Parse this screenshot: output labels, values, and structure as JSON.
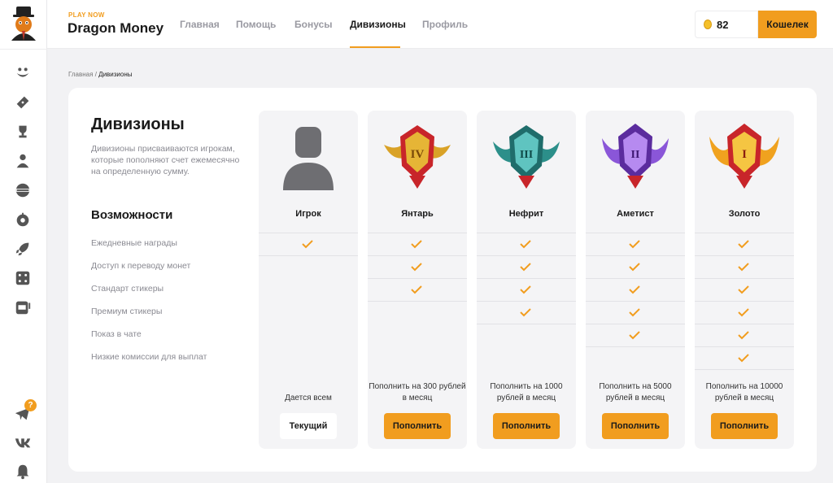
{
  "brand": {
    "tag": "PLAY NOW",
    "name": "Dragon Money"
  },
  "nav": {
    "items": [
      {
        "label": "Главная"
      },
      {
        "label": "Помощь"
      },
      {
        "label": "Бонусы"
      },
      {
        "label": "Дивизионы"
      },
      {
        "label": "Профиль"
      }
    ],
    "active": "Дивизионы"
  },
  "balance": {
    "value": "82"
  },
  "wallet": {
    "label": "Кошелек"
  },
  "breadcrumb": {
    "home": "Главная",
    "separator": "/",
    "current": "Дивизионы"
  },
  "divisions": {
    "title": "Дивизионы",
    "description": "Дивизионы присваиваются игрокам, которые пополняют счет ежемесячно на определенную сумму.",
    "features_title": "Возможности",
    "features": [
      "Ежедневные награды",
      "Доступ к переводу монет",
      "Стандарт стикеры",
      "Премиум стикеры",
      "Показ в чате",
      "Низкие комиссии для выплат"
    ],
    "tiers": [
      {
        "name": "Игрок",
        "icon": "user-avatar-icon",
        "checks": 1,
        "note": "Дается всем",
        "button": "Текущий",
        "current": true
      },
      {
        "name": "Янтарь",
        "icon": "amber-emblem-icon",
        "rank": "IV",
        "checks": 3,
        "note": "Пополнить на 300 рублей в месяц",
        "button": "Пополнить",
        "current": false
      },
      {
        "name": "Нефрит",
        "icon": "jade-emblem-icon",
        "rank": "III",
        "checks": 4,
        "note": "Пополнить на 1000 рублей в месяц",
        "button": "Пополнить",
        "current": false
      },
      {
        "name": "Аметист",
        "icon": "amethyst-emblem-icon",
        "rank": "II",
        "checks": 5,
        "note": "Пополнить на 5000 рублей в месяц",
        "button": "Пополнить",
        "current": false
      },
      {
        "name": "Золото",
        "icon": "gold-emblem-icon",
        "rank": "I",
        "checks": 6,
        "note": "Пополнить на 10000 рублей в месяц",
        "button": "Пополнить",
        "current": false
      }
    ]
  },
  "sidebar": {
    "icons": [
      "smile-icon",
      "ticket-icon",
      "trophy-icon",
      "user-icon",
      "jackpot-icon",
      "wheel-icon",
      "rocket-icon",
      "dice-icon",
      "slot-machine-icon",
      "telegram-icon",
      "vk-icon",
      "bell-icon"
    ],
    "telegram_badge": "?"
  },
  "colors": {
    "accent": "#f19d1f",
    "text": "#1a1a1a",
    "muted": "#8a8a92",
    "card_bg": "#f4f4f6"
  }
}
